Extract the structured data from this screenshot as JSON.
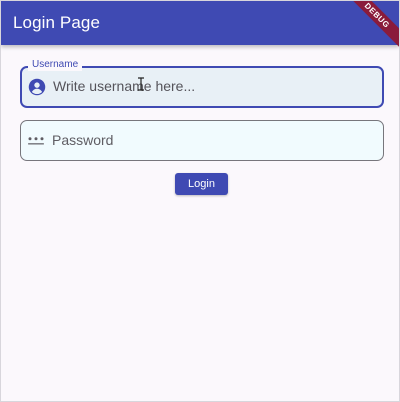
{
  "app": {
    "title": "Login Page",
    "debug_banner": "DEBUG"
  },
  "form": {
    "username": {
      "label": "Username",
      "placeholder": "Write username here...",
      "icon": "account-circle-icon"
    },
    "password": {
      "placeholder": "Password",
      "icon": "password-dots-icon"
    },
    "login_label": "Login"
  },
  "colors": {
    "primary": "#3f4ab3",
    "background": "#fbf8fc",
    "username_fill": "#e8f0f6",
    "password_fill": "#f1fbfe",
    "debug_banner": "#8a1b3b"
  }
}
